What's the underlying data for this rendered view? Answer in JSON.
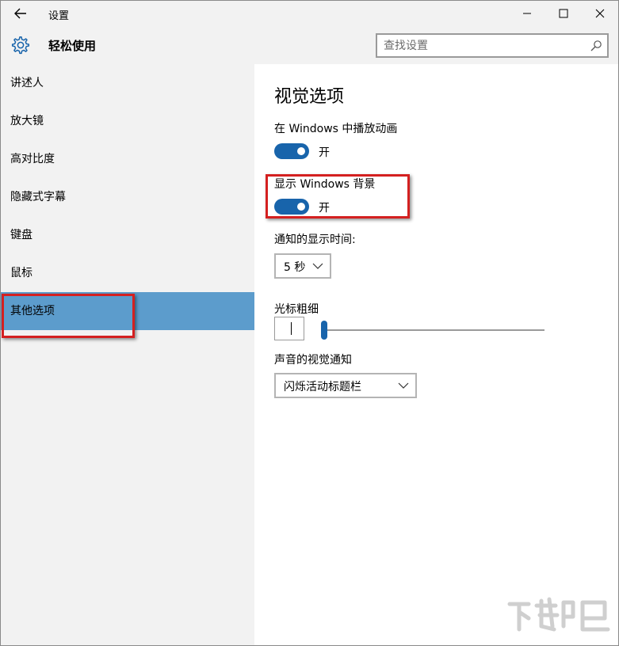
{
  "window": {
    "title": "设置",
    "back_icon": "back-arrow-icon",
    "controls": [
      "minimize-icon",
      "maximize-icon",
      "close-icon"
    ]
  },
  "header": {
    "icon": "gear-icon",
    "title": "轻松使用",
    "search": {
      "placeholder": "查找设置",
      "value": ""
    }
  },
  "sidebar": {
    "items": [
      {
        "label": "讲述人"
      },
      {
        "label": "放大镜"
      },
      {
        "label": "高对比度"
      },
      {
        "label": "隐藏式字幕"
      },
      {
        "label": "键盘"
      },
      {
        "label": "鼠标"
      },
      {
        "label": "其他选项",
        "selected": true
      }
    ]
  },
  "main": {
    "section_title": "视觉选项",
    "animations": {
      "label": "在 Windows 中播放动画",
      "state": "开",
      "on": true
    },
    "background": {
      "label": "显示 Windows 背景",
      "state": "开",
      "on": true
    },
    "notification": {
      "label": "通知的显示时间:",
      "value": "5 秒"
    },
    "cursor": {
      "label": "光标粗细",
      "level": 1
    },
    "visual_sound": {
      "label": "声音的视觉通知",
      "value": "闪烁活动标题栏"
    }
  },
  "colors": {
    "accent": "#1864ab",
    "selected": "#5c9ccc",
    "chrome": "#f2f2f2",
    "annotation": "#d42020"
  }
}
